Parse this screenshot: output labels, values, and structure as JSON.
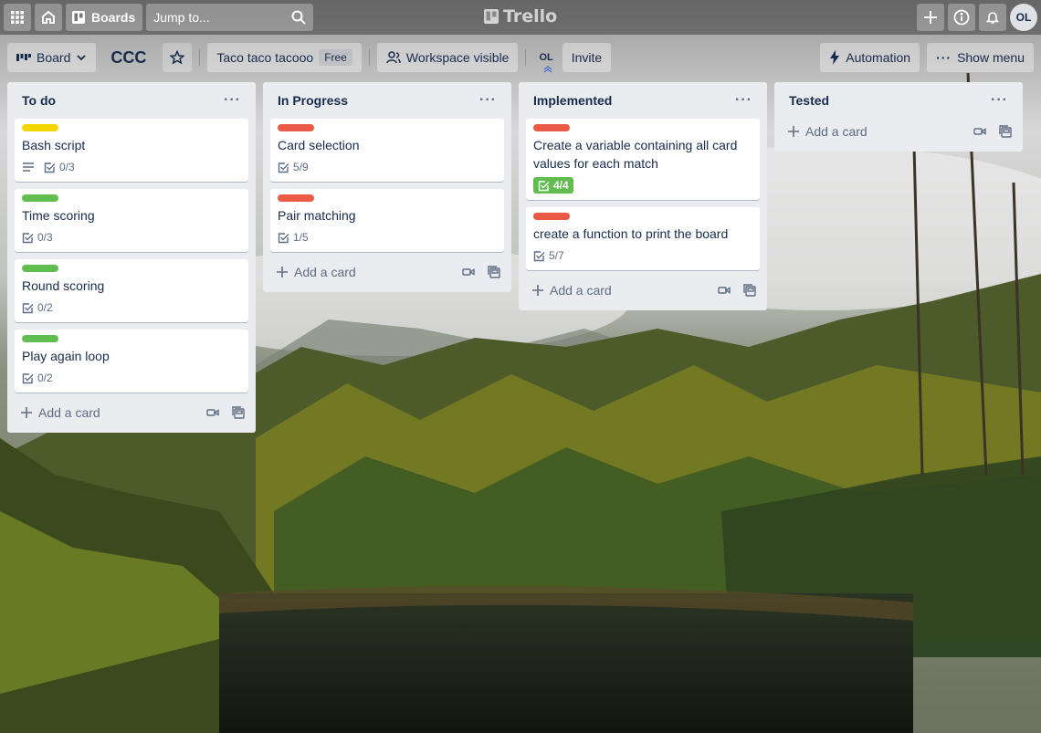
{
  "nav": {
    "boards_label": "Boards",
    "search_placeholder": "Jump to...",
    "logo_text": "Trello",
    "avatar_initials": "OL"
  },
  "header": {
    "view_label": "Board",
    "board_title": "CCC",
    "workspace_name": "Taco taco tacooo",
    "plan_badge": "Free",
    "visibility_label": "Workspace visible",
    "member_initials": "OL",
    "invite_label": "Invite",
    "automation_label": "Automation",
    "show_menu_label": "Show menu"
  },
  "add_card_label": "Add a card",
  "colors": {
    "yellow": "#f2d600",
    "green": "#61bd4f",
    "red": "#eb5a46"
  },
  "lists": [
    {
      "title": "To do",
      "cards": [
        {
          "title": "Bash script",
          "label": "yellow",
          "description": true,
          "checklist": "0/3"
        },
        {
          "title": "Time scoring",
          "label": "green",
          "checklist": "0/3"
        },
        {
          "title": "Round scoring",
          "label": "green",
          "checklist": "0/2"
        },
        {
          "title": "Play again loop",
          "label": "green",
          "checklist": "0/2"
        }
      ]
    },
    {
      "title": "In Progress",
      "cards": [
        {
          "title": "Card selection",
          "label": "red",
          "checklist": "5/9"
        },
        {
          "title": "Pair matching",
          "label": "red",
          "checklist": "1/5"
        }
      ]
    },
    {
      "title": "Implemented",
      "cards": [
        {
          "title": "Create a variable containing all card values for each match",
          "label": "red",
          "checklist": "4/4",
          "complete": true
        },
        {
          "title": "create a function to print the board",
          "label": "red",
          "checklist": "5/7"
        }
      ]
    },
    {
      "title": "Tested",
      "cards": []
    }
  ]
}
